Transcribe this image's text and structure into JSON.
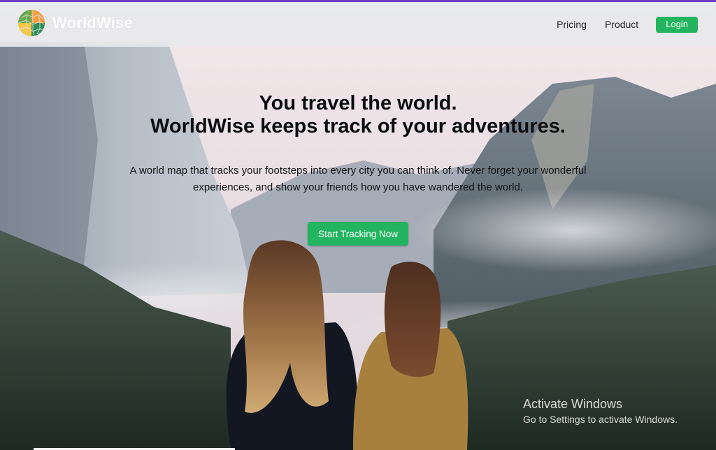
{
  "brand": {
    "name": "WorldWise",
    "icon": "worldwise-globe-logo",
    "accent": "#22b45e"
  },
  "nav": {
    "links": [
      {
        "label": "Pricing"
      },
      {
        "label": "Product"
      }
    ],
    "login_label": "Login"
  },
  "hero": {
    "title_line1": "You travel the world.",
    "title_line2": "WorldWise keeps track of your adventures.",
    "subtitle": "A world map that tracks your footsteps into every city you can think of. Never forget your wonderful experiences, and show your friends how you have wandered the world.",
    "cta_label": "Start Tracking Now"
  },
  "watermark": {
    "title": "Activate Windows",
    "subtitle": "Go to Settings to activate Windows."
  },
  "colors": {
    "top_accent": "#6e3fc6",
    "button": "#22b45e"
  }
}
